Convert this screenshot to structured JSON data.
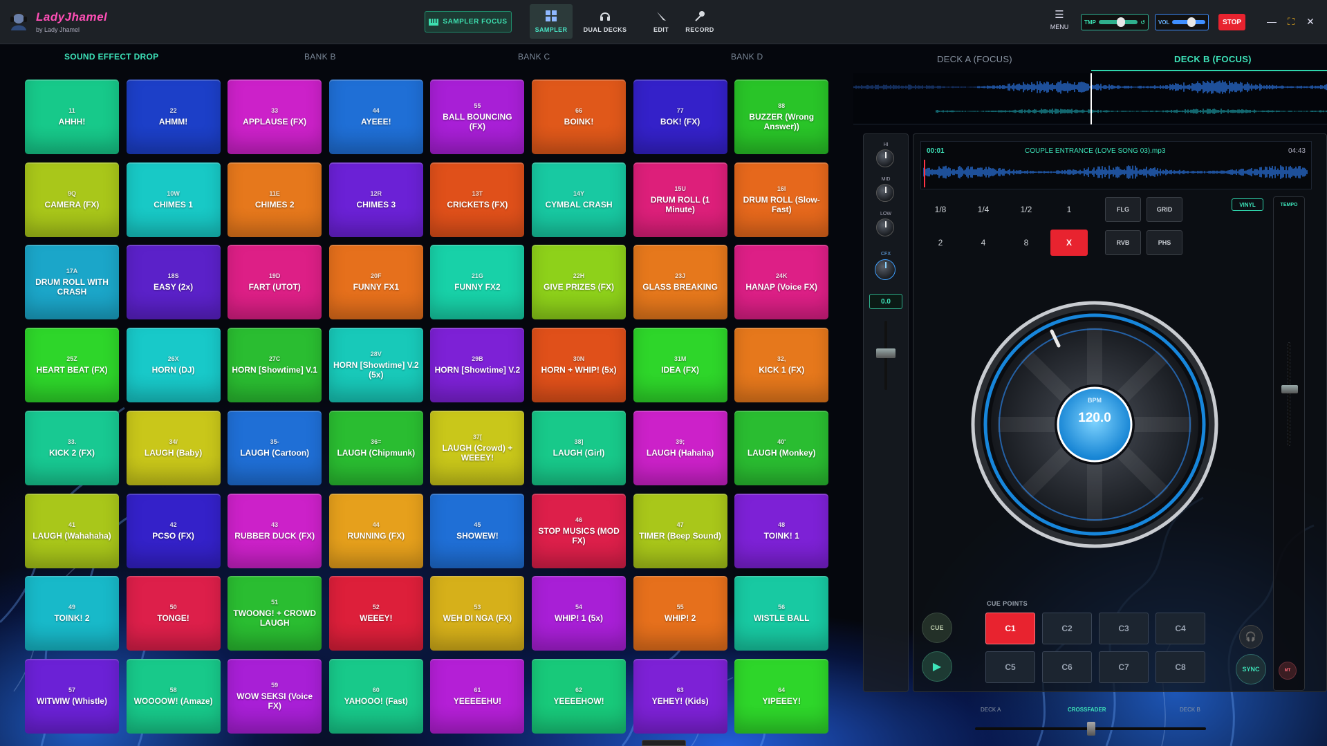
{
  "app": {
    "brand": "LadyJhamel",
    "brand_sub": "by Lady Jhamel"
  },
  "toolbar": {
    "sampler_focus": "SAMPLER FOCUS",
    "tools": [
      {
        "label": "SAMPLER",
        "icon": "grid-icon"
      },
      {
        "label": "DUAL DECKS",
        "icon": "headphones-icon"
      },
      {
        "label": "EDIT",
        "icon": "pencil-icon"
      },
      {
        "label": "RECORD",
        "icon": "microphone-icon"
      }
    ],
    "menu": "MENU",
    "tmp_label": "TMP",
    "vol_label": "VOL",
    "stop": "STOP"
  },
  "banks": [
    "SOUND EFFECT DROP",
    "BANK B",
    "BANK C",
    "BANK D"
  ],
  "pads": [
    {
      "key": "11",
      "label": "AHHH!",
      "color": "#17c98a"
    },
    {
      "key": "22",
      "label": "AHMM!",
      "color": "#1c3fc8"
    },
    {
      "key": "33",
      "label": "APPLAUSE (FX)",
      "color": "#cc21c9"
    },
    {
      "key": "44",
      "label": "AYEEE!",
      "color": "#1f6fd6"
    },
    {
      "key": "55",
      "label": "BALL BOUNCING (FX)",
      "color": "#a81fd6"
    },
    {
      "key": "66",
      "label": "BOINK!",
      "color": "#e0581a"
    },
    {
      "key": "77",
      "label": "BOK! (FX)",
      "color": "#3421c9"
    },
    {
      "key": "88",
      "label": "BUZZER (Wrong Answer))",
      "color": "#29c428"
    },
    {
      "key": "9Q",
      "label": "CAMERA (FX)",
      "color": "#a9c71a"
    },
    {
      "key": "10W",
      "label": "CHIMES 1",
      "color": "#18c9c6"
    },
    {
      "key": "11E",
      "label": "CHIMES 2",
      "color": "#e6781c"
    },
    {
      "key": "12R",
      "label": "CHIMES 3",
      "color": "#6b21d6"
    },
    {
      "key": "13T",
      "label": "CRICKETS (FX)",
      "color": "#e0501a"
    },
    {
      "key": "14Y",
      "label": "CYMBAL CRASH",
      "color": "#18c9a2"
    },
    {
      "key": "15U",
      "label": "DRUM ROLL (1 Minute)",
      "color": "#dd1f7a"
    },
    {
      "key": "16I",
      "label": "DRUM ROLL (Slow-Fast)",
      "color": "#e6681c"
    },
    {
      "key": "17A",
      "label": "DRUM ROLL WITH CRASH",
      "color": "#1ba6c9"
    },
    {
      "key": "18S",
      "label": "EASY (2x)",
      "color": "#5b21c9"
    },
    {
      "key": "19D",
      "label": "FART (UTOT)",
      "color": "#dd1f86"
    },
    {
      "key": "20F",
      "label": "FUNNY FX1",
      "color": "#e6701c"
    },
    {
      "key": "21G",
      "label": "FUNNY FX2",
      "color": "#18d1a8"
    },
    {
      "key": "22H",
      "label": "GIVE PRIZES (FX)",
      "color": "#8ed11a"
    },
    {
      "key": "23J",
      "label": "GLASS BREAKING",
      "color": "#e6781c"
    },
    {
      "key": "24K",
      "label": "HANAP (Voice FX)",
      "color": "#dd1f86"
    },
    {
      "key": "25Z",
      "label": "HEART BEAT (FX)",
      "color": "#2ed62a"
    },
    {
      "key": "26X",
      "label": "HORN (DJ)",
      "color": "#18c9c9"
    },
    {
      "key": "27C",
      "label": "HORN [Showtime] V.1",
      "color": "#2abd31"
    },
    {
      "key": "28V",
      "label": "HORN [Showtime] V.2 (5x)",
      "color": "#18c9b9"
    },
    {
      "key": "29B",
      "label": "HORN [Showtime] V.2",
      "color": "#7d21d6"
    },
    {
      "key": "30N",
      "label": "HORN + WHIP! (5x)",
      "color": "#e0501a"
    },
    {
      "key": "31M",
      "label": "IDEA (FX)",
      "color": "#2ed62a"
    },
    {
      "key": "32,",
      "label": "KICK 1 (FX)",
      "color": "#e6781c"
    },
    {
      "key": "33.",
      "label": "KICK 2 (FX)",
      "color": "#18c992"
    },
    {
      "key": "34/",
      "label": "LAUGH (Baby)",
      "color": "#c9c71a"
    },
    {
      "key": "35-",
      "label": "LAUGH (Cartoon)",
      "color": "#1f6fd6"
    },
    {
      "key": "36=",
      "label": "LAUGH (Chipmunk)",
      "color": "#2abd31"
    },
    {
      "key": "37[",
      "label": "LAUGH (Crowd) + WEEEY!",
      "color": "#c9c71a"
    },
    {
      "key": "38]",
      "label": "LAUGH (Girl)",
      "color": "#18c98a"
    },
    {
      "key": "39;",
      "label": "LAUGH (Hahaha)",
      "color": "#cc21c9"
    },
    {
      "key": "40'",
      "label": "LAUGH (Monkey)",
      "color": "#2abd31"
    },
    {
      "key": "41",
      "label": "LAUGH (Wahahaha)",
      "color": "#a9c71a"
    },
    {
      "key": "42",
      "label": "PCSO (FX)",
      "color": "#3421c9"
    },
    {
      "key": "43",
      "label": "RUBBER DUCK (FX)",
      "color": "#cc21c9"
    },
    {
      "key": "44",
      "label": "RUNNING (FX)",
      "color": "#e6a01c"
    },
    {
      "key": "45",
      "label": "SHOWEW!",
      "color": "#1f6fd6"
    },
    {
      "key": "46",
      "label": "STOP MUSICS (MOD FX)",
      "color": "#dd1f4a"
    },
    {
      "key": "47",
      "label": "TIMER (Beep Sound)",
      "color": "#a9c71a"
    },
    {
      "key": "48",
      "label": "TOINK! 1",
      "color": "#7d21d6"
    },
    {
      "key": "49",
      "label": "TOINK! 2",
      "color": "#18b9c9"
    },
    {
      "key": "50",
      "label": "TONGE!",
      "color": "#dd1f4a"
    },
    {
      "key": "51",
      "label": "TWOONG! + CROWD LAUGH",
      "color": "#2abd31"
    },
    {
      "key": "52",
      "label": "WEEEY!",
      "color": "#dd1f3a"
    },
    {
      "key": "53",
      "label": "WEH DI NGA (FX)",
      "color": "#d6b01a"
    },
    {
      "key": "54",
      "label": "WHIP! 1 (5x)",
      "color": "#a81fd6"
    },
    {
      "key": "55",
      "label": "WHIP! 2",
      "color": "#e6701c"
    },
    {
      "key": "56",
      "label": "WISTLE BALL",
      "color": "#18c9a2"
    },
    {
      "key": "57",
      "label": "WITWIW (Whistle)",
      "color": "#6b21d6"
    },
    {
      "key": "58",
      "label": "WOOOOW! (Amaze)",
      "color": "#18c98a"
    },
    {
      "key": "59",
      "label": "WOW SEKSI (Voice FX)",
      "color": "#a81fd6"
    },
    {
      "key": "60",
      "label": "YAHOOO! (Fast)",
      "color": "#18c98a"
    },
    {
      "key": "61",
      "label": "YEEEEEHU!",
      "color": "#b41fd6"
    },
    {
      "key": "62",
      "label": "YEEEEHOW!",
      "color": "#18c97a"
    },
    {
      "key": "63",
      "label": "YEHEY! (Kids)",
      "color": "#7d21d6"
    },
    {
      "key": "64",
      "label": "YIPEEEY!",
      "color": "#2ed62a"
    }
  ],
  "decks": {
    "tab_a": "DECK A (FOCUS)",
    "tab_b": "DECK B (FOCUS)"
  },
  "mixer": {
    "eq": [
      "HI",
      "MID",
      "LOW"
    ],
    "cfx": "CFX",
    "gain": "0.0"
  },
  "deck_b": {
    "time_current": "00:01",
    "track": "COUPLE ENTRANCE (LOVE SONG 03).mp3",
    "time_total": "04:43",
    "loops": [
      "1/8",
      "1/4",
      "1/2",
      "1",
      "2",
      "4",
      "8",
      "X"
    ],
    "fx": [
      "FLG",
      "GRID",
      "RVB",
      "PHS"
    ],
    "vinyl": "VINYL",
    "tempo": "TEMPO",
    "bpm_label": "BPM",
    "bpm": "120.0",
    "cue_title": "CUE POINTS",
    "cues": [
      "C1",
      "C2",
      "C3",
      "C4",
      "C5",
      "C6",
      "C7",
      "C8"
    ],
    "cue_btn": "CUE",
    "sync": "SYNC",
    "mt": "MT"
  },
  "crossfader": {
    "left": "DECK A",
    "center": "CROSSFADER",
    "right": "DECK B"
  }
}
